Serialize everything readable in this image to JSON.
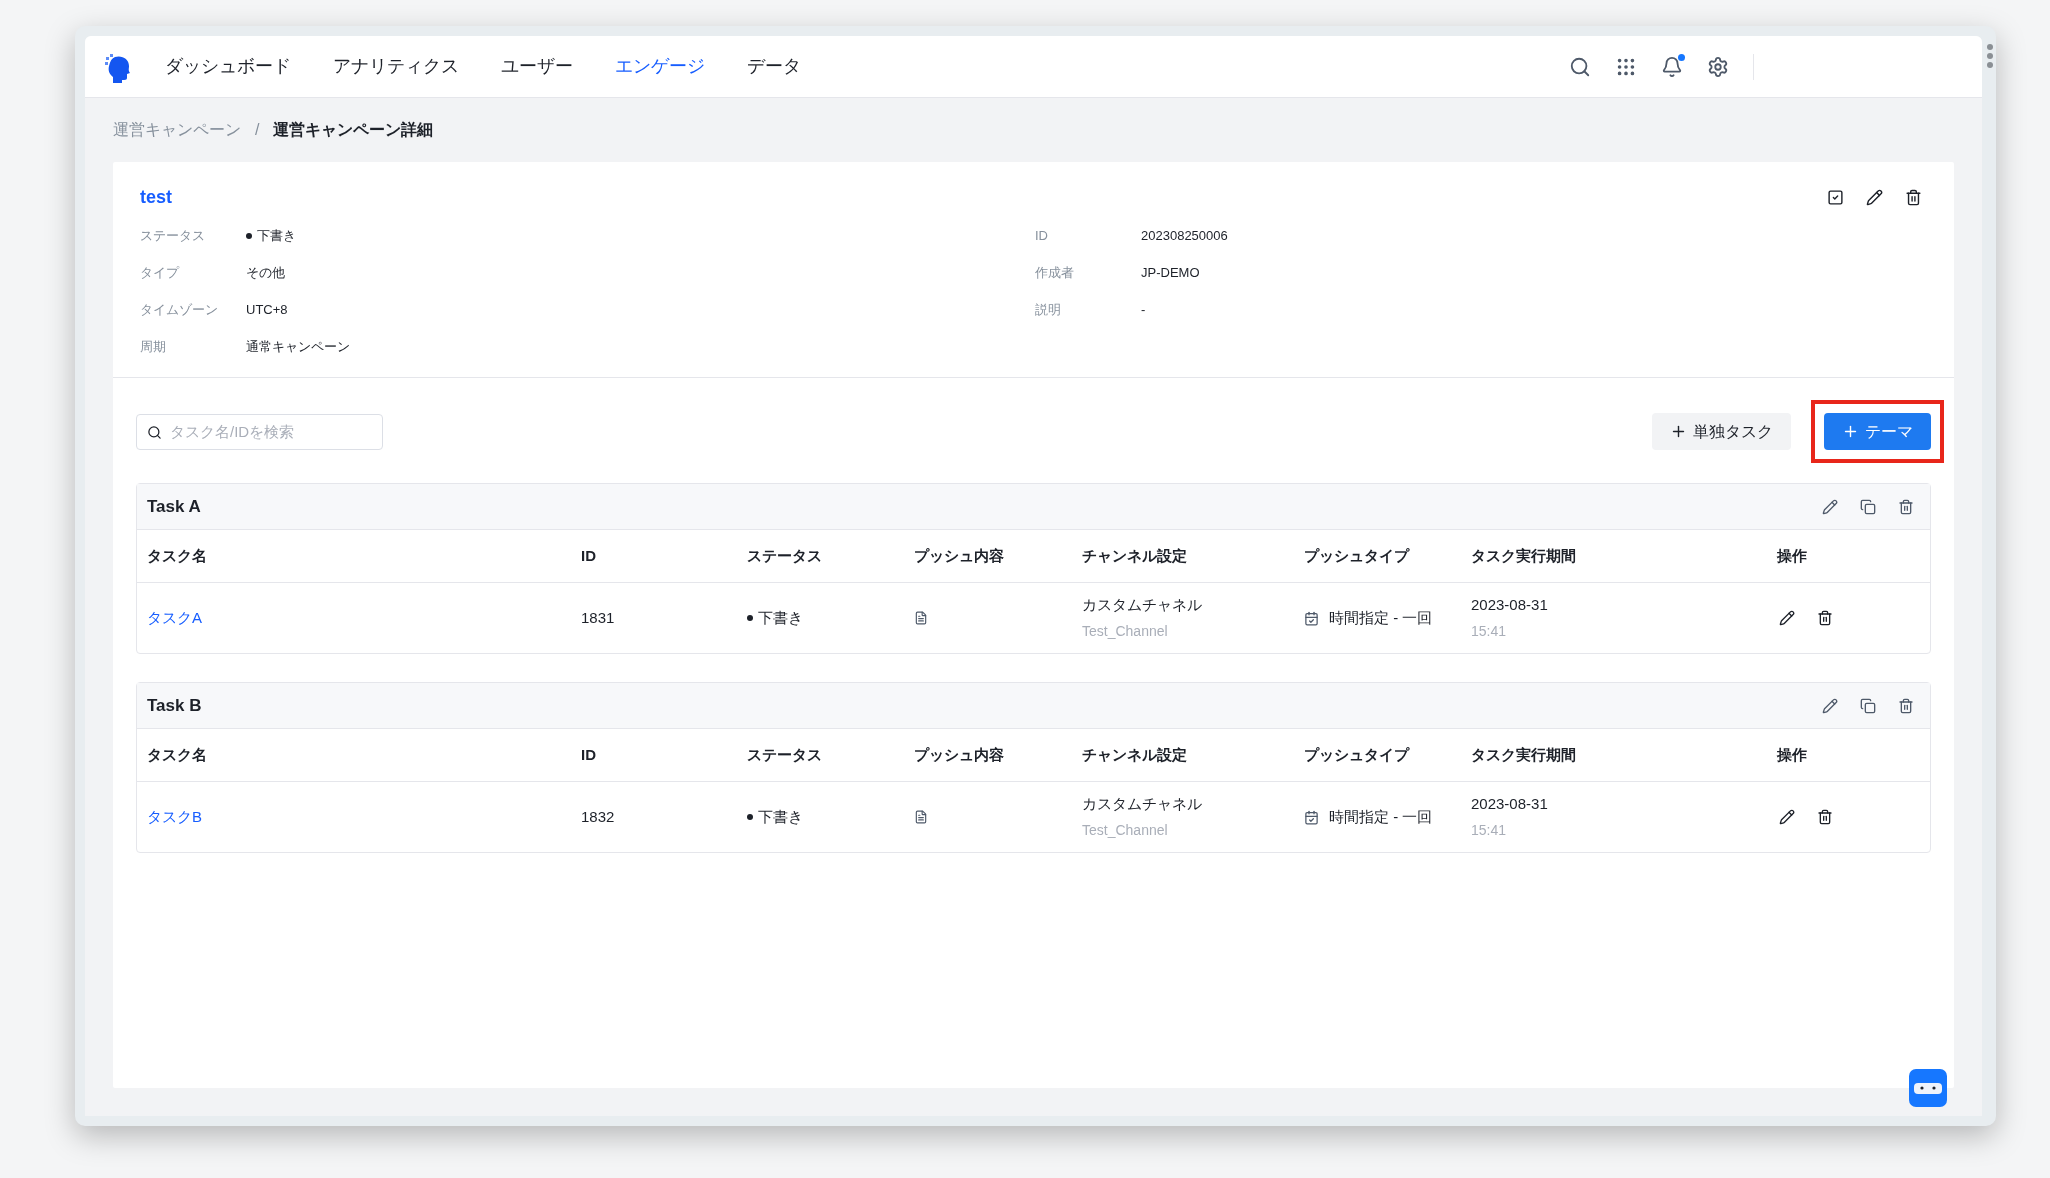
{
  "nav": {
    "items": [
      {
        "label": "ダッシュボード",
        "selected": false
      },
      {
        "label": "アナリティクス",
        "selected": false
      },
      {
        "label": "ユーザー",
        "selected": false
      },
      {
        "label": "エンゲージ",
        "selected": true
      },
      {
        "label": "データ",
        "selected": false
      }
    ],
    "notification_unread": true
  },
  "breadcrumb": [
    "運営キャンペーン",
    "運営キャンペーン詳細"
  ],
  "breadcrumb_separator": "/",
  "campaign": {
    "title": "test",
    "left_fields": [
      {
        "label": "ステータス",
        "value": "下書き",
        "kind": "status"
      },
      {
        "label": "タイプ",
        "value": "その他",
        "kind": "text"
      },
      {
        "label": "タイムゾーン",
        "value": "UTC+8",
        "kind": "text"
      },
      {
        "label": "周期",
        "value": "通常キャンペーン",
        "kind": "text"
      }
    ],
    "right_fields": [
      {
        "label": "ID",
        "value": "202308250006"
      },
      {
        "label": "作成者",
        "value": "JP-DEMO"
      },
      {
        "label": "説明",
        "value": "-"
      }
    ]
  },
  "search": {
    "placeholder": "タスク名/IDを検索"
  },
  "buttons": [
    {
      "label": "単独タスク",
      "kind": "secondary",
      "highlighted": false
    },
    {
      "label": "テーマ",
      "kind": "primary",
      "highlighted": true
    }
  ],
  "groups": [
    {
      "title": "Task A",
      "columns": [
        "タスク名",
        "ID",
        "ステータス",
        "プッシュ内容",
        "チャンネル設定",
        "プッシュタイプ",
        "タスク実行期間",
        "操作"
      ],
      "rows": [
        {
          "name": "タスクA",
          "id": "1831",
          "status": "下書き",
          "channel": "カスタムチャネル",
          "channel_sub": "Test_Channel",
          "push_type": "時間指定 - 一回",
          "date": "2023-08-31",
          "time": "15:41"
        }
      ]
    },
    {
      "title": "Task B",
      "columns": [
        "タスク名",
        "ID",
        "ステータス",
        "プッシュ内容",
        "チャンネル設定",
        "プッシュタイプ",
        "タスク実行期間",
        "操作"
      ],
      "rows": [
        {
          "name": "タスクB",
          "id": "1832",
          "status": "下書き",
          "channel": "カスタムチャネル",
          "channel_sub": "Test_Channel",
          "push_type": "時間指定 - 一回",
          "date": "2023-08-31",
          "time": "15:41"
        }
      ]
    }
  ]
}
